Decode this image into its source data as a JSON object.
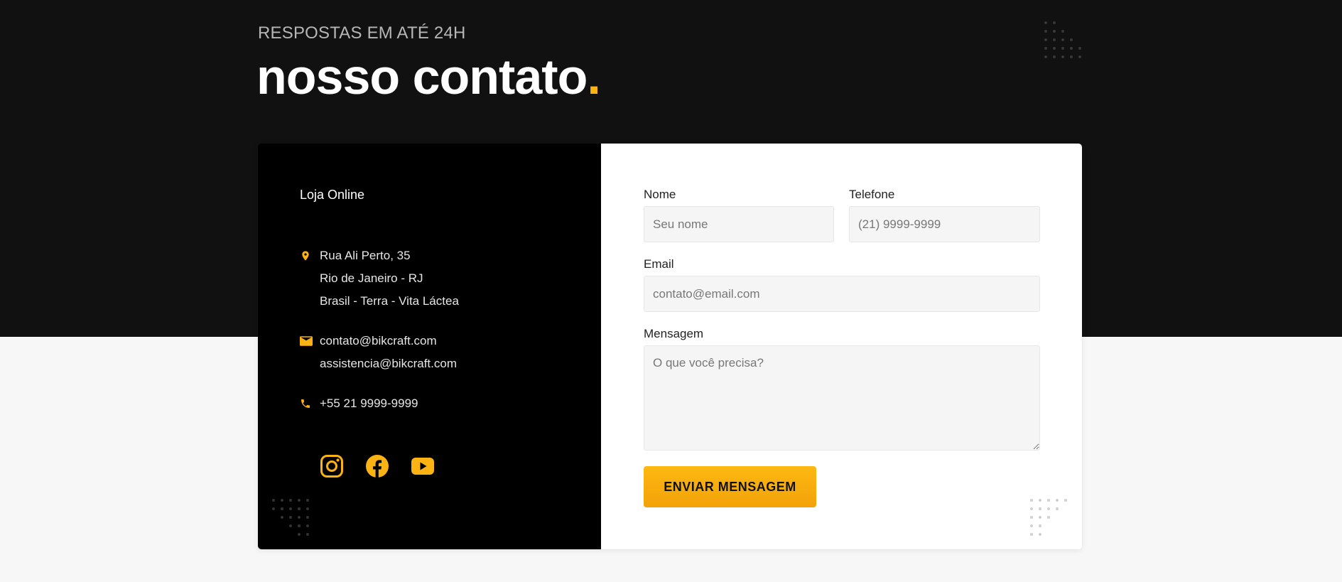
{
  "header": {
    "subtitle": "RESPOSTAS EM ATÉ 24H",
    "title": "nosso contato",
    "title_accent": "."
  },
  "contact_info": {
    "store_label": "Loja Online",
    "address": [
      "Rua Ali Perto, 35",
      "Rio de Janeiro - RJ",
      "Brasil - Terra - Vita Láctea"
    ],
    "emails": [
      "contato@bikcraft.com",
      "assistencia@bikcraft.com"
    ],
    "phone": "+55 21 9999-9999",
    "icons": {
      "address": "location-pin-icon",
      "email": "mail-icon",
      "phone": "phone-icon"
    },
    "socials": [
      {
        "name": "instagram-icon"
      },
      {
        "name": "facebook-icon"
      },
      {
        "name": "youtube-icon"
      }
    ]
  },
  "form": {
    "name_label": "Nome",
    "name_placeholder": "Seu nome",
    "phone_label": "Telefone",
    "phone_placeholder": "(21) 9999-9999",
    "email_label": "Email",
    "email_placeholder": "contato@email.com",
    "message_label": "Mensagem",
    "message_placeholder": "O que você precisa?",
    "submit_label": "ENVIAR MENSAGEM"
  },
  "colors": {
    "accent": "#fbb313",
    "dark_band": "#111111",
    "card_left": "#000000",
    "background": "#f7f7f7"
  }
}
